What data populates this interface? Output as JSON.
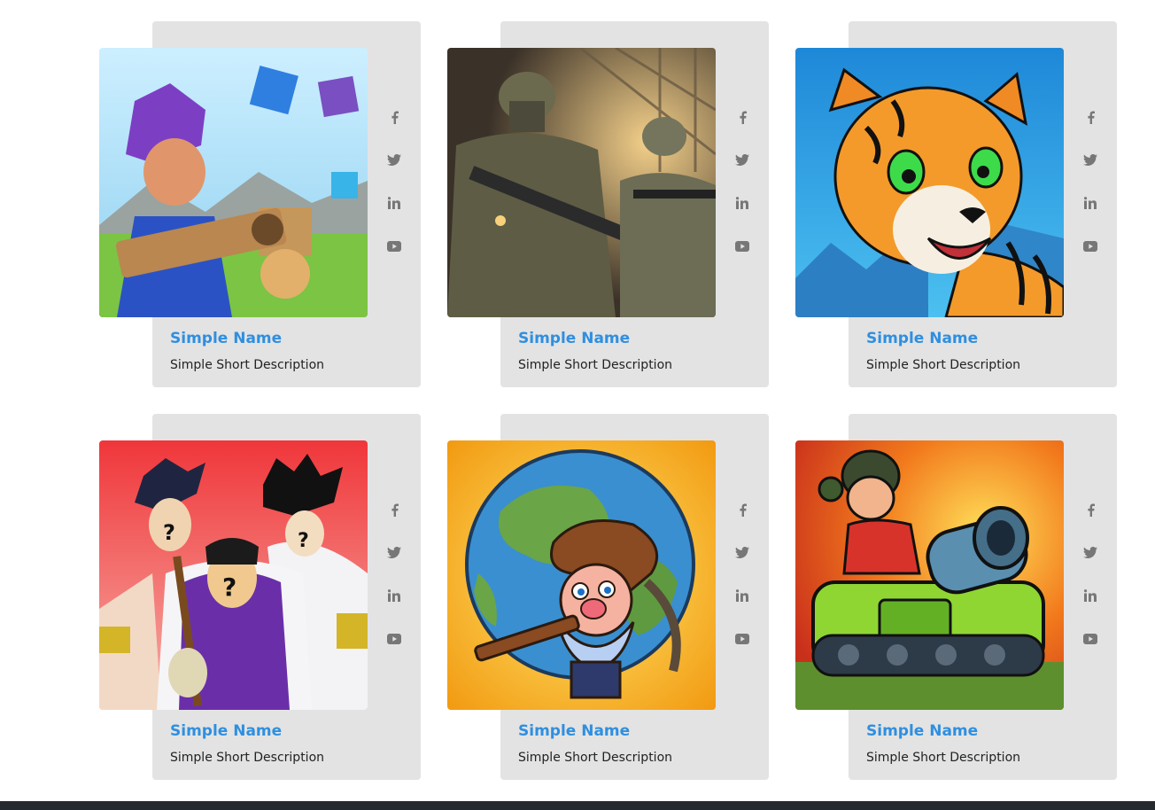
{
  "cards": [
    {
      "name": "Simple Name",
      "description": "Simple Short Description",
      "image": "blocky-hero-bazooka-artwork"
    },
    {
      "name": "Simple Name",
      "description": "Simple Short Description",
      "image": "soldiers-shooter-artwork"
    },
    {
      "name": "Simple Name",
      "description": "Simple Short Description",
      "image": "cartoon-tiger-artwork"
    },
    {
      "name": "Simple Name",
      "description": "Simple Short Description",
      "image": "anime-silhouette-quiz-artwork"
    },
    {
      "name": "Simple Name",
      "description": "Simple Short Description",
      "image": "miner-on-globe-artwork"
    },
    {
      "name": "Simple Name",
      "description": "Simple Short Description",
      "image": "cartoon-tank-soldier-artwork"
    }
  ],
  "social_icons": [
    "facebook-icon",
    "twitter-icon",
    "linkedin-icon",
    "youtube-icon"
  ],
  "colors": {
    "panel": "#e3e3e3",
    "name_link": "#2f8fe0",
    "description": "#222222",
    "social_icon": "#777777",
    "footer": "#262a2f"
  }
}
